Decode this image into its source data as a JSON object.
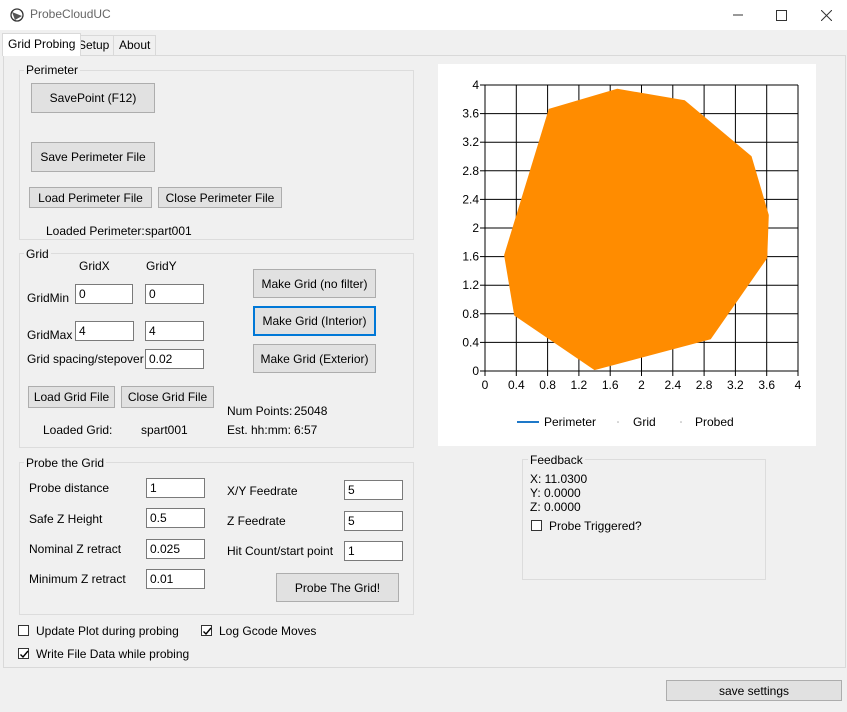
{
  "window": {
    "title": "ProbeCloudUC"
  },
  "tabs": [
    "Grid Probing",
    "Setup",
    "About"
  ],
  "perimeter": {
    "group_title": "Perimeter",
    "savepoint_label": "SavePoint (F12)",
    "save_file_label": "Save Perimeter File",
    "load_file_label": "Load Perimeter File",
    "close_file_label": "Close Perimeter File",
    "loaded_label": "Loaded Perimeter:",
    "loaded_value": "spart001"
  },
  "grid": {
    "group_title": "Grid",
    "col_x": "GridX",
    "col_y": "GridY",
    "min_label": "GridMin",
    "min_x": "0",
    "min_y": "0",
    "max_label": "GridMax",
    "max_x": "4",
    "max_y": "4",
    "spacing_label": "Grid spacing/stepover",
    "spacing_value": "0.02",
    "make_nofilter_label": "Make Grid (no filter)",
    "make_interior_label": "Make Grid (Interior)",
    "make_exterior_label": "Make Grid (Exterior)",
    "load_label": "Load Grid File",
    "close_label": "Close Grid File",
    "loaded_label": "Loaded Grid:",
    "loaded_value": "spart001",
    "numpoints_label": "Num Points:",
    "numpoints_value": "25048",
    "est_label": "Est. hh:mm:",
    "est_value": "6:57"
  },
  "probe": {
    "group_title": "Probe the Grid",
    "distance_label": "Probe distance",
    "distance_value": "1",
    "safez_label": "Safe Z Height",
    "safez_value": "0.5",
    "nominal_label": "Nominal Z retract",
    "nominal_value": "0.025",
    "minimum_label": "Minimum Z retract",
    "minimum_value": "0.01",
    "xy_feed_label": "X/Y Feedrate",
    "xy_feed_value": "5",
    "z_feed_label": "Z Feedrate",
    "z_feed_value": "5",
    "hitcount_label": "Hit Count/start point",
    "hitcount_value": "1",
    "probe_button_label": "Probe The Grid!"
  },
  "options": {
    "update_plot_label": "Update Plot during probing",
    "update_plot_checked": false,
    "log_gcode_label": "Log Gcode Moves",
    "log_gcode_checked": true,
    "write_file_label": "Write File Data while probing",
    "write_file_checked": true
  },
  "feedback": {
    "group_title": "Feedback",
    "x": "X: 11.0300",
    "y": "Y: 0.0000",
    "z": "Z: 0.0000",
    "probe_triggered_label": "Probe Triggered?",
    "probe_triggered_checked": false
  },
  "save_settings_label": "save settings",
  "colors": {
    "fill": "#ff8c00",
    "perimeter_line": "#1e78c8",
    "focus": "#0078d7"
  },
  "chart_data": {
    "type": "area",
    "xlim": [
      0,
      4
    ],
    "ylim": [
      0,
      4
    ],
    "xticks": [
      "0",
      "0.4",
      "0.8",
      "1.2",
      "1.6",
      "2",
      "2.4",
      "2.8",
      "3.2",
      "3.6",
      "4"
    ],
    "yticks": [
      "0",
      "0.4",
      "0.8",
      "1.2",
      "1.6",
      "2",
      "2.4",
      "2.8",
      "3.2",
      "3.6",
      "4"
    ],
    "grid": true,
    "legend": [
      "Perimeter",
      "Grid",
      "Probed"
    ],
    "legend_position": "bottom",
    "series": [
      {
        "name": "Perimeter",
        "x": [
          1.69,
          2.55,
          3.4,
          3.62,
          3.6,
          2.88,
          1.4,
          0.38,
          0.25,
          0.82,
          1.69
        ],
        "y": [
          3.94,
          3.78,
          3.0,
          2.18,
          1.58,
          0.45,
          0.02,
          0.78,
          1.62,
          3.66,
          3.94
        ]
      }
    ]
  }
}
